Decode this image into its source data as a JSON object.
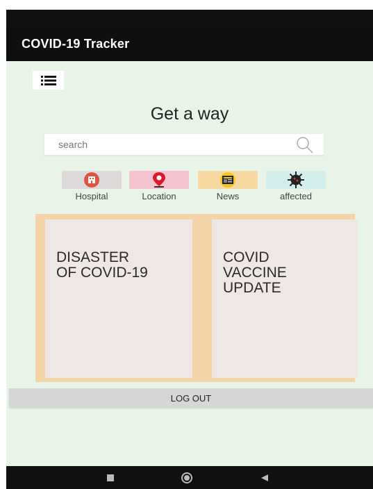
{
  "app_bar": {
    "title": "COVID-19 Tracker"
  },
  "menu": {
    "icon": "list-menu-icon"
  },
  "main": {
    "heading": "Get a way",
    "search": {
      "placeholder": "search",
      "icon": "search-icon"
    }
  },
  "categories": [
    {
      "label": "Hospital",
      "icon": "hospital-icon"
    },
    {
      "label": "Location",
      "icon": "location-pin-icon"
    },
    {
      "label": "News",
      "icon": "news-icon"
    },
    {
      "label": "affected",
      "icon": "virus-icon"
    }
  ],
  "cards": [
    {
      "title": "DISASTER\nOF COVID-19"
    },
    {
      "title": "COVID\nVACCINE\nUPDATE"
    }
  ],
  "logout": {
    "label": "LOG OUT"
  },
  "colors": {
    "app_bar": "#0f0f0f",
    "background": "#e9f4e9",
    "cards_frame": "#f3d4a8",
    "card": "#efe6e6",
    "logout": "#d6d6d6"
  }
}
